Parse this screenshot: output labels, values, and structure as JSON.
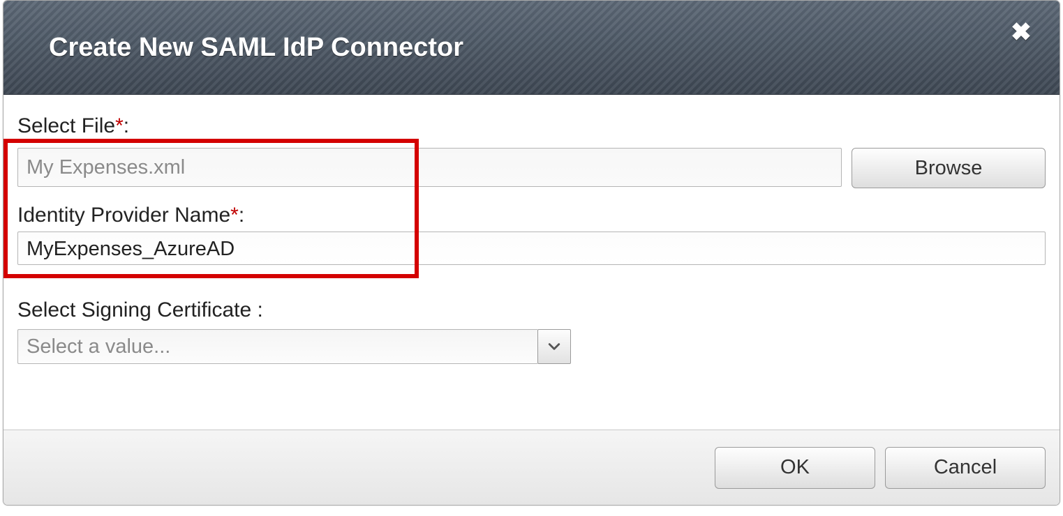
{
  "dialog": {
    "title": "Create New SAML IdP Connector",
    "close_label": "✖"
  },
  "fields": {
    "select_file": {
      "label": "Select File",
      "required_mark": "*",
      "colon": ":",
      "value": "My Expenses.xml",
      "browse_label": "Browse"
    },
    "idp_name": {
      "label": "Identity Provider Name",
      "required_mark": "*",
      "colon": ":",
      "value": "MyExpenses_AzureAD"
    },
    "signing_cert": {
      "label": "Select Signing Certificate ",
      "colon": ":",
      "placeholder": "Select a value..."
    }
  },
  "buttons": {
    "ok": "OK",
    "cancel": "Cancel"
  }
}
